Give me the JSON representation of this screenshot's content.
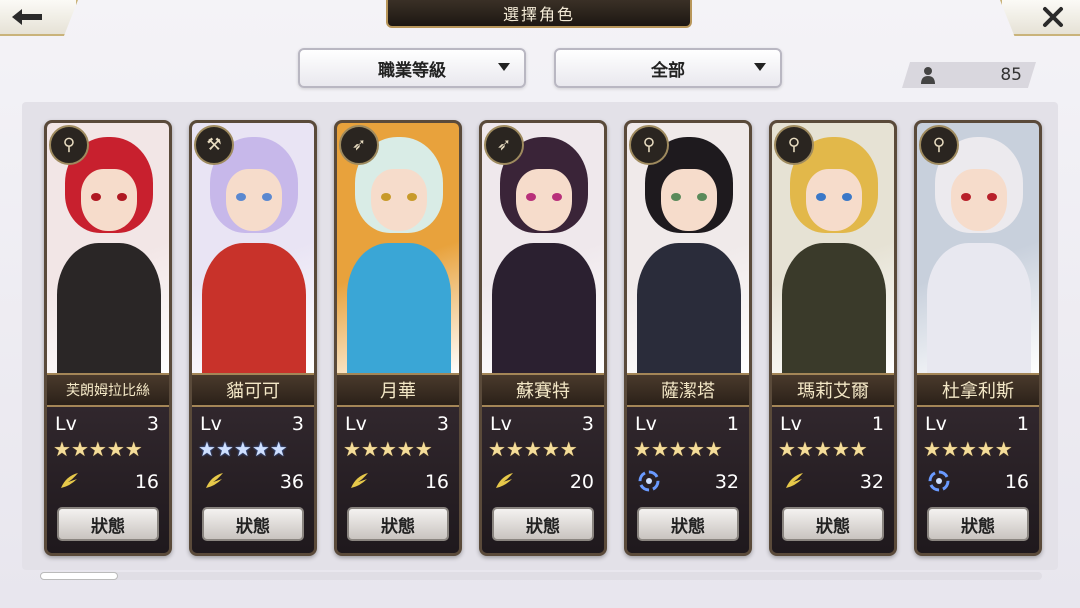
{
  "header": {
    "title": "選擇角色",
    "back_icon": "arrow-left-icon",
    "close_icon": "close-x-icon"
  },
  "filters": {
    "job_level": "職業等級",
    "scope": "全部"
  },
  "owned_count": "85",
  "status_label": "狀態",
  "lv_label": "Lv",
  "characters": [
    {
      "name": "芙朗姆拉比絲",
      "level": "3",
      "stars": 5,
      "star_color": "gold",
      "element": "wind",
      "cost": "16",
      "weapon": "staff",
      "hair": "#c8202e",
      "body": "#2a2626",
      "eye": "#b01822",
      "bg": "#f2e6e6"
    },
    {
      "name": "貓可可",
      "level": "3",
      "stars": 5,
      "star_color": "blue",
      "element": "wind",
      "cost": "36",
      "weapon": "axe",
      "hair": "#c7b8ea",
      "body": "#c8322a",
      "eye": "#5a88d0",
      "bg": "#e9e4f4"
    },
    {
      "name": "月華",
      "level": "3",
      "stars": 5,
      "star_color": "gold",
      "element": "wind",
      "cost": "16",
      "weapon": "spear",
      "hair": "#d9ece6",
      "body": "#3aa6d6",
      "eye": "#c89a2a",
      "bg": "#e8a23c"
    },
    {
      "name": "蘇賽特",
      "level": "3",
      "stars": 5,
      "star_color": "gold",
      "element": "wind",
      "cost": "20",
      "weapon": "spear",
      "hair": "#3a2438",
      "body": "#2b2030",
      "eye": "#b8307a",
      "bg": "#efe8ec"
    },
    {
      "name": "薩潔塔",
      "level": "1",
      "stars": 5,
      "star_color": "gold",
      "element": "water",
      "cost": "32",
      "weapon": "staff",
      "hair": "#1e1a1e",
      "body": "#2a2c3a",
      "eye": "#5a8a5a",
      "bg": "#f0eaea"
    },
    {
      "name": "瑪莉艾爾",
      "level": "1",
      "stars": 5,
      "star_color": "gold",
      "element": "wind",
      "cost": "32",
      "weapon": "staff",
      "hair": "#e2b84a",
      "body": "#3a3a2a",
      "eye": "#3a78c8",
      "bg": "#e6e2d4"
    },
    {
      "name": "杜拿利斯",
      "level": "1",
      "stars": 5,
      "star_color": "gold",
      "element": "water",
      "cost": "16",
      "weapon": "staff",
      "hair": "#eceaee",
      "body": "#e8e8f0",
      "eye": "#b8202a",
      "bg": "#c8d0dc"
    }
  ]
}
